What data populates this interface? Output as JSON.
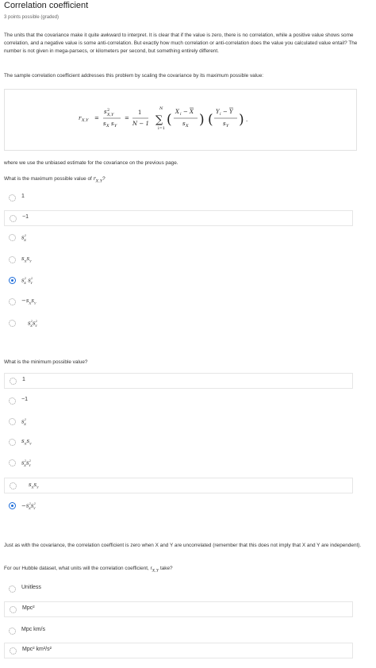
{
  "header": {
    "title": "Correlation coefficient",
    "points": "3 points possible (graded)"
  },
  "intro": {
    "p1": "The units that the covariance make it quite awkward to interpret. It is clear that if the value is zero, there is no correlation, while a positive value shows some correlation, and a negative value is some anti-correlation. But exactly how much correlation or anti-correlation does the value you calculated value entail? The number is not given in mega-parsecs, or kilometers per second, but something entirely different.",
    "p2": "The sample correlation coefficient addresses this problem by scaling the covariance by its maximum possible value:"
  },
  "formula": {
    "lhs": "r",
    "lhs_sub": "X,Y",
    "num": "s",
    "num_sup": "2",
    "num_sub": "X,Y",
    "den": "s",
    "den_sub1": "X",
    "den_sub2": "Y",
    "one": "1",
    "n_minus_one": "N − 1",
    "sum_top": "N",
    "sum_bottom": "i=1",
    "frac1_num": "X",
    "frac1_den": "s",
    "frac2_num": "Y",
    "frac2_den": "s"
  },
  "after_formula": "where we use the unbiased estimate for the covariance on the previous page.",
  "q1": {
    "prompt": "What is the maximum possible value of",
    "prompt_math": "r",
    "prompt_math_sub": "X,Y",
    "options": [
      {
        "label": "1",
        "selected": false
      },
      {
        "label": "−1",
        "selected": false
      },
      {
        "label": "s²_X",
        "selected": false
      },
      {
        "label": "s_X s_Y",
        "selected": false
      },
      {
        "label": "s²_X s²_Y",
        "selected": true
      },
      {
        "label": "−s_X s_Y",
        "selected": false
      },
      {
        "label": "s²_X s²_Y",
        "selected": false
      }
    ]
  },
  "q2": {
    "prompt": "What is the minimum possible value?",
    "options": [
      {
        "label": "1",
        "selected": false
      },
      {
        "label": "−1",
        "selected": false
      },
      {
        "label": "s²_X",
        "selected": false
      },
      {
        "label": "s_X s_Y",
        "selected": false
      },
      {
        "label": "s²_X s²_Y",
        "selected": false
      },
      {
        "label": "s_X s_Y",
        "selected": false
      },
      {
        "label": "−s²_X s²_Y",
        "selected": true
      }
    ]
  },
  "mid": {
    "text": "Just as with the covariance, the correlation coefficient is zero when X and Y are uncorrelated (remember that this does not imply that X and Y are independent)."
  },
  "q3": {
    "prompt": "For our Hubble dataset, what units will the correlation coefficient, r",
    "prompt_sub": "X,Y",
    "prompt_tail": " take?",
    "options": [
      {
        "label": "Unitless",
        "selected": false
      },
      {
        "label": "Mpc²",
        "selected": false
      },
      {
        "label": "Mpc km/s",
        "selected": false
      },
      {
        "label": "Mpc² km²/s²",
        "selected": false
      }
    ]
  },
  "colors": {
    "accent": "#1b6bd9",
    "border": "#e6e6e6",
    "text": "#333333"
  }
}
